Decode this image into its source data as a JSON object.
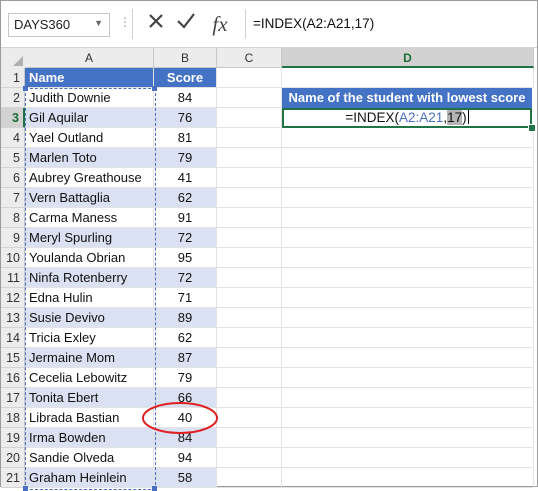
{
  "formula_bar": {
    "name_box": "DAYS360",
    "formula": "=INDEX(A2:A21,17)",
    "fx_label": "fx"
  },
  "columns": [
    "A",
    "B",
    "C",
    "D"
  ],
  "headers": {
    "name": "Name",
    "score": "Score"
  },
  "rows": [
    {
      "n": "1",
      "name": "Name",
      "score": "Score"
    },
    {
      "n": "2",
      "name": "Judith Downie",
      "score": "84"
    },
    {
      "n": "3",
      "name": "Gil Aquilar",
      "score": "76"
    },
    {
      "n": "4",
      "name": "Yael Outland",
      "score": "81"
    },
    {
      "n": "5",
      "name": "Marlen Toto",
      "score": "79"
    },
    {
      "n": "6",
      "name": "Aubrey Greathouse",
      "score": "41"
    },
    {
      "n": "7",
      "name": "Vern Battaglia",
      "score": "62"
    },
    {
      "n": "8",
      "name": "Carma Maness",
      "score": "91"
    },
    {
      "n": "9",
      "name": "Meryl Spurling",
      "score": "72"
    },
    {
      "n": "10",
      "name": "Youlanda Obrian",
      "score": "95"
    },
    {
      "n": "11",
      "name": "Ninfa Rotenberry",
      "score": "72"
    },
    {
      "n": "12",
      "name": "Edna Hulin",
      "score": "71"
    },
    {
      "n": "13",
      "name": "Susie Devivo",
      "score": "89"
    },
    {
      "n": "14",
      "name": "Tricia Exley",
      "score": "62"
    },
    {
      "n": "15",
      "name": "Jermaine Mom",
      "score": "87"
    },
    {
      "n": "16",
      "name": "Cecelia Lebowitz",
      "score": "79"
    },
    {
      "n": "17",
      "name": "Tonita Ebert",
      "score": "66"
    },
    {
      "n": "18",
      "name": "Librada Bastian",
      "score": "40"
    },
    {
      "n": "19",
      "name": "Irma Bowden",
      "score": "84"
    },
    {
      "n": "20",
      "name": "Sandie Olveda",
      "score": "94"
    },
    {
      "n": "21",
      "name": "Graham Heinlein",
      "score": "58"
    }
  ],
  "d_title": "Name of the student with lowest score",
  "d_edit": {
    "prefix": "=INDEX(",
    "ref": "A2:A21",
    "comma": ",",
    "arg": "17",
    "suffix": ")"
  },
  "colors": {
    "header_blue": "#4472c4",
    "band_light": "#d9e1f2",
    "excel_green": "#217346",
    "highlight_red": "#e02020"
  },
  "icons": [
    "cancel-icon",
    "enter-check-icon",
    "insert-function-icon"
  ]
}
